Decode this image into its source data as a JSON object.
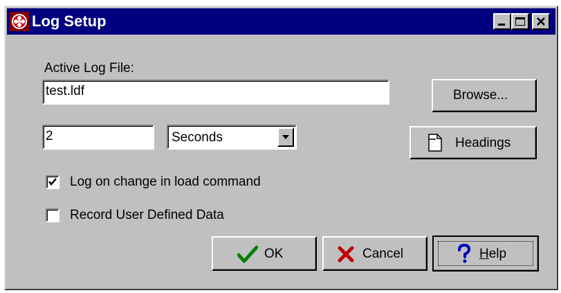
{
  "window": {
    "title": "Log Setup",
    "controls": {
      "minimize_icon": "minimize-icon",
      "maximize_icon": "maximize-icon",
      "close_icon": "close-icon"
    }
  },
  "log_file": {
    "label": "Active Log File:",
    "value": "test.ldf",
    "browse_label": "Browse..."
  },
  "interval": {
    "value": "2",
    "unit_selected": "Seconds"
  },
  "headings_label": "Headings",
  "options": {
    "log_on_change": {
      "label": "Log on change in load command",
      "checked": true
    },
    "record_user_data": {
      "label": "Record User Defined Data",
      "checked": false
    }
  },
  "buttons": {
    "ok": "OK",
    "cancel": "Cancel",
    "help_prefix": "",
    "help_underlined": "H",
    "help_rest": "elp"
  },
  "colors": {
    "title_bar": "#000080",
    "face": "#c0c0c0",
    "ok_check": "#008000",
    "cancel_x": "#c00000",
    "help_q": "#0000c0"
  }
}
